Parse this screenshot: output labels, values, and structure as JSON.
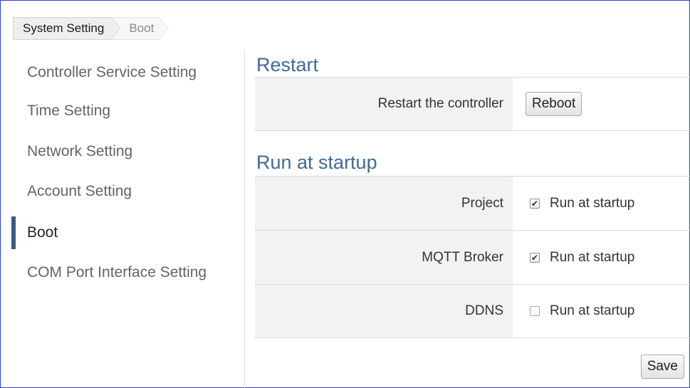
{
  "breadcrumb": {
    "root": "System Setting",
    "current": "Boot"
  },
  "sidebar": {
    "items": [
      {
        "label": "Controller Service Setting"
      },
      {
        "label": "Time Setting"
      },
      {
        "label": "Network Setting"
      },
      {
        "label": "Account Setting"
      },
      {
        "label": "Boot"
      },
      {
        "label": "COM Port Interface Setting"
      }
    ],
    "active_index": 4
  },
  "restart": {
    "title": "Restart",
    "label": "Restart the controller",
    "button": "Reboot"
  },
  "startup": {
    "title": "Run at startup",
    "rows": [
      {
        "label": "Project",
        "option": "Run at startup",
        "checked": true
      },
      {
        "label": "MQTT Broker",
        "option": "Run at startup",
        "checked": true
      },
      {
        "label": "DDNS",
        "option": "Run at startup",
        "checked": false
      }
    ]
  },
  "footer": {
    "save": "Save"
  },
  "colors": {
    "section_title": "#3f6a98",
    "active_marker": "#3b5a86",
    "row_label_bg": "#f2f2f2"
  }
}
